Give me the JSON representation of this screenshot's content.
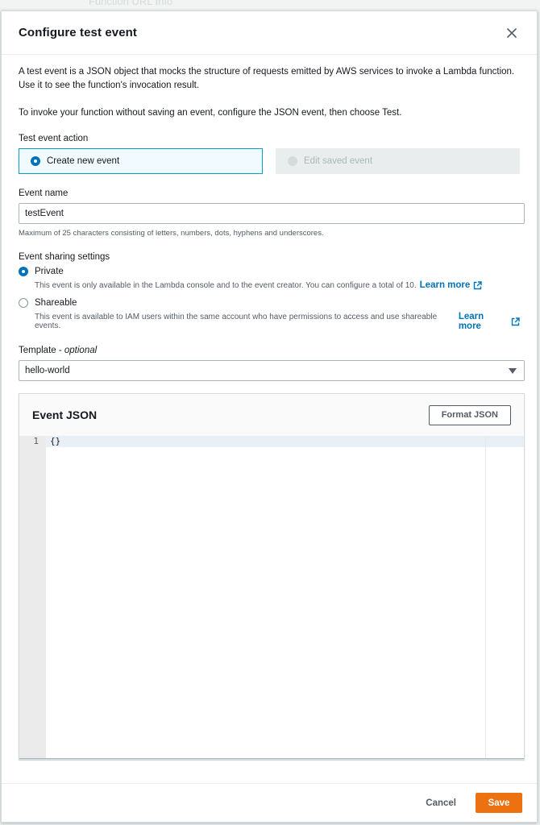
{
  "backdrop": {
    "text": "Function URL  Info"
  },
  "modal": {
    "title": "Configure test event",
    "description_1": "A test event is a JSON object that mocks the structure of requests emitted by AWS services to invoke a Lambda function. Use it to see the function's invocation result.",
    "description_2": "To invoke your function without saving an event, configure the JSON event, then choose Test."
  },
  "test_event_action": {
    "label": "Test event action",
    "create_new": "Create new event",
    "edit_saved": "Edit saved event",
    "selected": "create_new"
  },
  "event_name": {
    "label": "Event name",
    "value": "testEvent",
    "hint": "Maximum of 25 characters consisting of letters, numbers, dots, hyphens and underscores."
  },
  "sharing": {
    "label": "Event sharing settings",
    "private_label": "Private",
    "private_desc": "This event is only available in the Lambda console and to the event creator. You can configure a total of 10.",
    "shareable_label": "Shareable",
    "shareable_desc": "This event is available to IAM users within the same account who have permissions to access and use shareable events.",
    "learn_more": "Learn more",
    "selected": "private"
  },
  "template": {
    "label": "Template - ",
    "label_optional": "optional",
    "value": "hello-world"
  },
  "editor": {
    "title": "Event JSON",
    "format_button": "Format JSON",
    "lines": [
      {
        "number": "1",
        "text": "{}"
      }
    ]
  },
  "footer": {
    "cancel": "Cancel",
    "save": "Save"
  },
  "colors": {
    "accent": "#0073bb",
    "primary_button": "#ec7211",
    "selected_tile_bg": "#f1faff",
    "selected_tile_border": "#00a1c9"
  }
}
